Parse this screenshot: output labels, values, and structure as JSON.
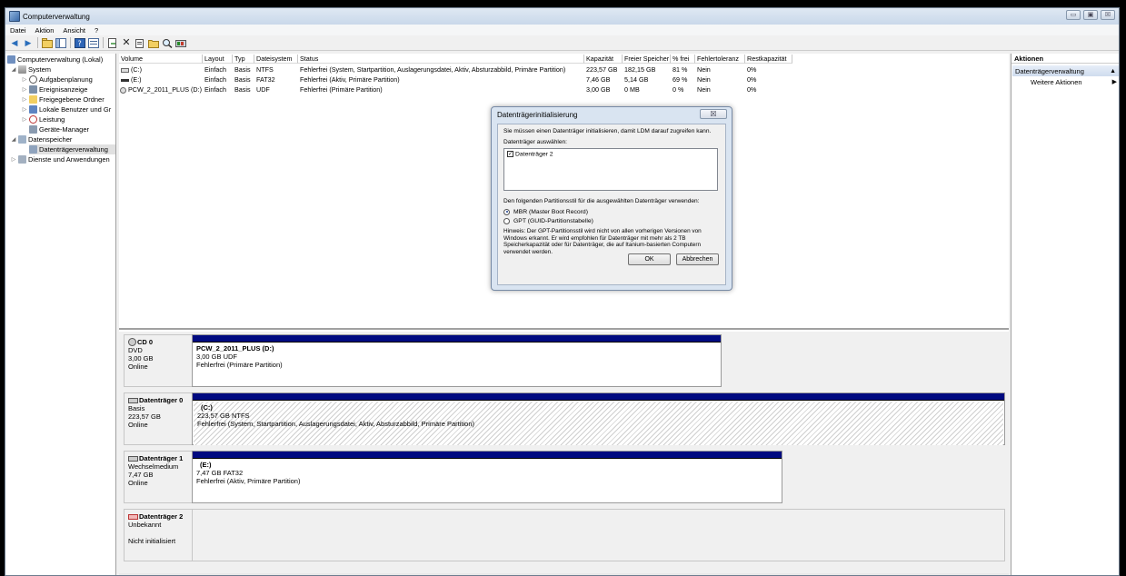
{
  "window": {
    "title": "Computerverwaltung",
    "buttons": [
      "▭",
      "▣",
      "☒"
    ]
  },
  "menu": [
    "Datei",
    "Aktion",
    "Ansicht",
    "?"
  ],
  "toolbar_icons": [
    "back-icon",
    "forward-icon",
    "up-folder-icon",
    "show-tree-icon",
    "help-icon",
    "properties-icon",
    "export-icon",
    "delete-icon",
    "new-icon",
    "open-icon",
    "search-icon",
    "format-icon"
  ],
  "tree": {
    "items": [
      {
        "label": "Computerverwaltung (Lokal)",
        "level": 0
      },
      {
        "label": "System",
        "level": 1
      },
      {
        "label": "Aufgabenplanung",
        "level": 2
      },
      {
        "label": "Ereignisanzeige",
        "level": 2
      },
      {
        "label": "Freigegebene Ordner",
        "level": 2
      },
      {
        "label": "Lokale Benutzer und Gr",
        "level": 2
      },
      {
        "label": "Leistung",
        "level": 2
      },
      {
        "label": "Geräte-Manager",
        "level": 2
      },
      {
        "label": "Datenspeicher",
        "level": 1
      },
      {
        "label": "Datenträgerverwaltung",
        "level": 2
      },
      {
        "label": "Dienste und Anwendungen",
        "level": 1
      }
    ]
  },
  "volume_table": {
    "headers": [
      "Volume",
      "Layout",
      "Typ",
      "Dateisystem",
      "Status",
      "Kapazität",
      "Freier Speicher",
      "% frei",
      "Fehlertoleranz",
      "Restkapazität"
    ],
    "rows": [
      [
        "(C:)",
        "Einfach",
        "Basis",
        "NTFS",
        "Fehlerfrei (System, Startpartition, Auslagerungsdatei, Aktiv, Absturzabbild, Primäre Partition)",
        "223,57 GB",
        "182,15 GB",
        "81 %",
        "Nein",
        "0%"
      ],
      [
        "(E:)",
        "Einfach",
        "Basis",
        "FAT32",
        "Fehlerfrei (Aktiv, Primäre Partition)",
        "7,46 GB",
        "5,14 GB",
        "69 %",
        "Nein",
        "0%"
      ],
      [
        "PCW_2_2011_PLUS (D:)",
        "Einfach",
        "Basis",
        "UDF",
        "Fehlerfrei (Primäre Partition)",
        "3,00 GB",
        "0 MB",
        "0 %",
        "Nein",
        "0%"
      ]
    ]
  },
  "disks": [
    {
      "name": "CD 0",
      "type": "DVD",
      "size": "3,00 GB",
      "state": "Online",
      "part_title": "PCW_2_2011_PLUS  (D:)",
      "part_size": "3,00 GB UDF",
      "part_status": "Fehlerfrei (Primäre Partition)"
    },
    {
      "name": "Datenträger 0",
      "type": "Basis",
      "size": "223,57 GB",
      "state": "Online",
      "part_title": "(C:)",
      "part_size": "223,57 GB NTFS",
      "part_status": "Fehlerfrei (System, Startpartition, Auslagerungsdatei, Aktiv, Absturzabbild, Primäre Partition)"
    },
    {
      "name": "Datenträger 1",
      "type": "Wechselmedium",
      "size": "7,47 GB",
      "state": "Online",
      "part_title": "(E:)",
      "part_size": "7,47 GB FAT32",
      "part_status": "Fehlerfrei (Aktiv, Primäre Partition)"
    },
    {
      "name": "Datenträger 2",
      "type": "Unbekannt",
      "size": "",
      "state": "Nicht initialisiert"
    }
  ],
  "actions": {
    "header": "Aktionen",
    "selected": "Datenträgerverwaltung",
    "more": "Weitere Aktionen"
  },
  "dialog": {
    "title": "Datenträgerinitialisierung",
    "close": "☒",
    "intro": "Sie müssen einen Datenträger initialisieren, damit LDM darauf zugreifen kann.",
    "select_label": "Datenträger auswählen:",
    "disk_item": "Datenträger 2",
    "style_label": "Den folgenden Partitionsstil für die ausgewählten Datenträger verwenden:",
    "mbr": "MBR (Master Boot Record)",
    "gpt": "GPT (GUID-Partitionstabelle)",
    "hint": "Hinweis: Der GPT-Partitionsstil wird nicht von allen vorherigen Versionen von Windows erkannt. Er wird empfohlen für Datenträger mit mehr als 2 TB Speicherkapazität oder für Datenträger, die auf Itanium-basierten Computern verwendet werden.",
    "ok": "OK",
    "cancel": "Abbrechen"
  }
}
